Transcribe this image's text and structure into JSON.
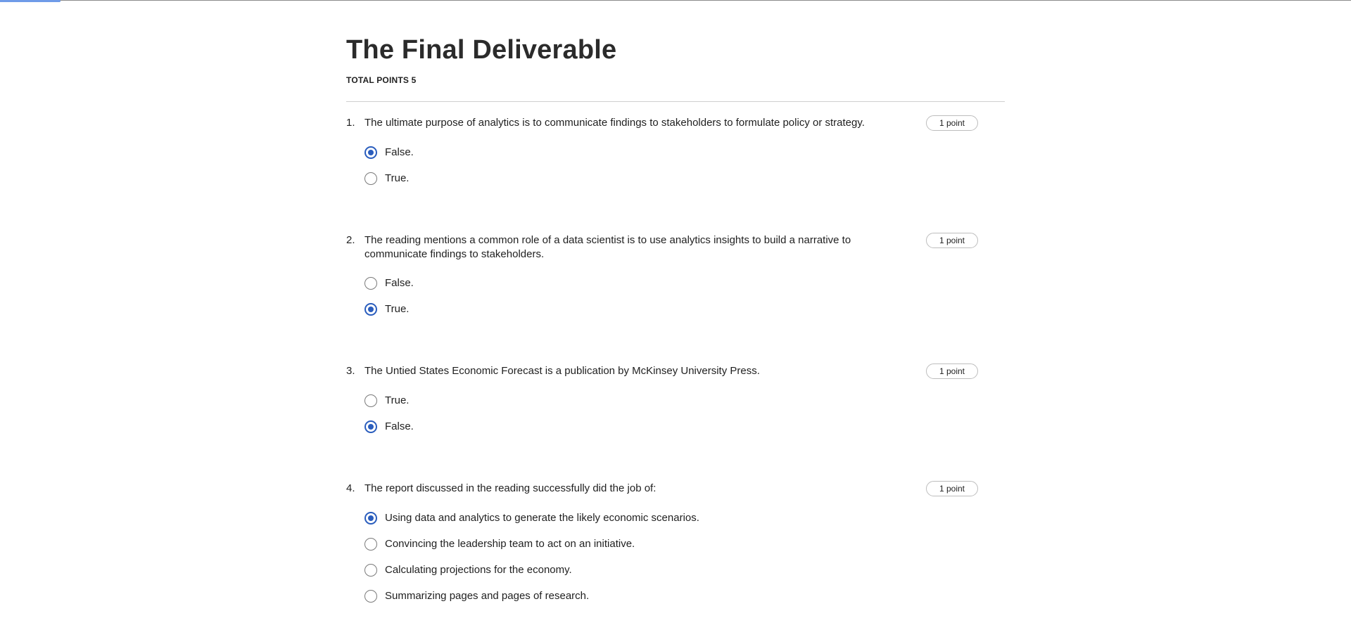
{
  "header": {
    "title": "The Final Deliverable",
    "total_points": "TOTAL POINTS 5",
    "progress_fraction": 0.045
  },
  "colors": {
    "accent": "#2a5dbd",
    "progress": "#6f9be8",
    "divider": "#cfcfcf"
  },
  "questions": [
    {
      "number": "1.",
      "text": "The ultimate purpose of analytics is to communicate findings to stakeholders to formulate policy or strategy.",
      "points": "1 point",
      "options": [
        {
          "label": "False.",
          "selected": true
        },
        {
          "label": "True.",
          "selected": false
        }
      ]
    },
    {
      "number": "2.",
      "text": "The reading mentions a common role of a data scientist is to use analytics insights to build a narrative to communicate findings to stakeholders.",
      "points": "1 point",
      "options": [
        {
          "label": "False.",
          "selected": false
        },
        {
          "label": "True.",
          "selected": true
        }
      ]
    },
    {
      "number": "3.",
      "text": "The Untied States Economic Forecast is a publication by McKinsey University Press.",
      "points": "1 point",
      "options": [
        {
          "label": "True.",
          "selected": false
        },
        {
          "label": "False.",
          "selected": true
        }
      ]
    },
    {
      "number": "4.",
      "text": "The report discussed in the reading successfully did the job of:",
      "points": "1 point",
      "options": [
        {
          "label": "Using data and analytics to generate the likely economic scenarios.",
          "selected": true
        },
        {
          "label": "Convincing the leadership team to act on an initiative.",
          "selected": false
        },
        {
          "label": "Calculating projections for the economy.",
          "selected": false
        },
        {
          "label": "Summarizing pages and pages of research.",
          "selected": false
        }
      ]
    }
  ]
}
